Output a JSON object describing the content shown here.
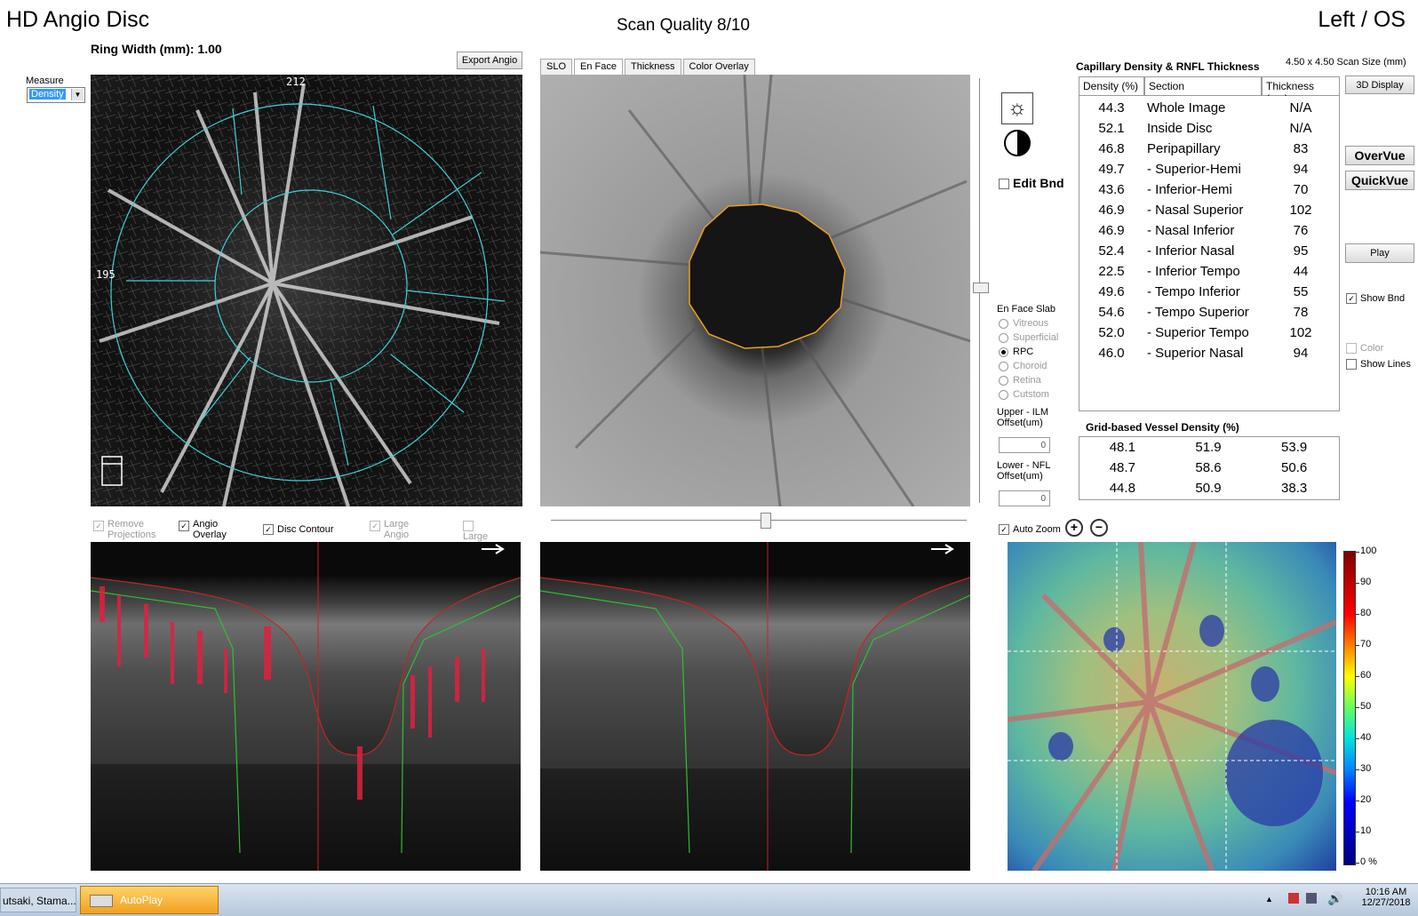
{
  "header": {
    "title": "HD Angio Disc",
    "scan_quality": "Scan Quality 8/10",
    "eye": "Left / OS",
    "ring_width": "Ring Width (mm): 1.00"
  },
  "measure": {
    "label": "Measure",
    "value": "Density"
  },
  "export_button": "Export Angio",
  "angio_labels": {
    "top": "212",
    "left": "195"
  },
  "tabs": [
    "SLO",
    "En Face",
    "Thickness",
    "Color Overlay"
  ],
  "tools": {
    "edit_bnd": "Edit Bnd"
  },
  "slab": {
    "title": "En Face Slab",
    "options": [
      "Vitreous",
      "Superficial",
      "RPC",
      "Choroid",
      "Retina",
      "Cutstom"
    ],
    "selected": "RPC",
    "upper_label": "Upper - ILM Offset(um)",
    "upper_value": "0",
    "lower_label": "Lower - NFL Offset(um)",
    "lower_value": "0"
  },
  "density_table": {
    "title": "Capillary Density & RNFL Thickness",
    "scan_size": "4.50 x 4.50 Scan Size (mm)",
    "headers": [
      "Density (%)",
      "Section",
      "Thickness (µm)"
    ],
    "rows": [
      [
        "44.3",
        "Whole Image",
        "N/A"
      ],
      [
        "52.1",
        "Inside Disc",
        "N/A"
      ],
      [
        "46.8",
        "Peripapillary",
        "83"
      ],
      [
        "49.7",
        "- Superior-Hemi",
        "94"
      ],
      [
        "43.6",
        "- Inferior-Hemi",
        "70"
      ],
      [
        "46.9",
        "- Nasal Superior",
        "102"
      ],
      [
        "46.9",
        "- Nasal Inferior",
        "76"
      ],
      [
        "52.4",
        "- Inferior Nasal",
        "95"
      ],
      [
        "22.5",
        "- Inferior Tempo",
        "44"
      ],
      [
        "49.6",
        "- Tempo Inferior",
        "55"
      ],
      [
        "54.6",
        "- Tempo Superior",
        "78"
      ],
      [
        "52.0",
        "- Superior Tempo",
        "102"
      ],
      [
        "46.0",
        "- Superior Nasal",
        "94"
      ]
    ]
  },
  "grid_density": {
    "title": "Grid-based Vessel Density (%)",
    "rows": [
      [
        "48.1",
        "51.9",
        "53.9"
      ],
      [
        "48.7",
        "58.6",
        "50.6"
      ],
      [
        "44.8",
        "50.9",
        "38.3"
      ]
    ]
  },
  "right_buttons": {
    "display3d": "3D Display",
    "overvue": "OverVue",
    "quickvue": "QuickVue",
    "play": "Play"
  },
  "right_checks": {
    "show_bnd": "Show Bnd",
    "color": "Color",
    "show_lines": "Show Lines"
  },
  "bottom_checks": {
    "remove_projections": "Remove Projections",
    "angio_overlay": "Angio Overlay",
    "disc_contour": "Disc Contour",
    "large_angio": "Large Angio",
    "large_oct": "Large Oct"
  },
  "auto_zoom": "Auto Zoom",
  "color_scale": [
    "100",
    "90",
    "80",
    "70",
    "60",
    "50",
    "40",
    "30",
    "20",
    "10",
    "0 %"
  ],
  "taskbar": {
    "user": "utsaki, Stama...",
    "app": "AutoPlay",
    "time": "10:16 AM",
    "date": "12/27/2018"
  },
  "colors": {
    "cyan": "#40d0d8",
    "disc_outline": "#e8a020",
    "red_line": "#d02020",
    "green_line": "#30c030"
  }
}
